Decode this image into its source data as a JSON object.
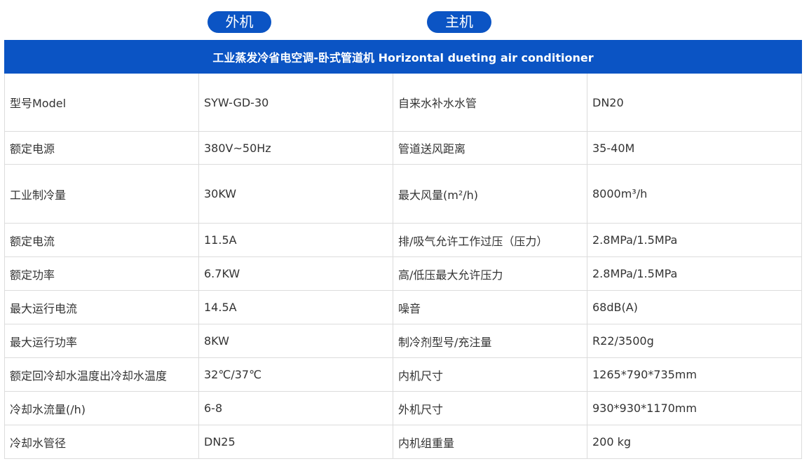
{
  "tabs": {
    "outdoor_label": "外机",
    "main_label": "主机"
  },
  "colors": {
    "accent": "#0b54c4",
    "border": "#dcdcdc",
    "text": "#333333"
  },
  "table": {
    "title": "工业蒸发冷省电空调-卧式管道机 Horizontal dueting air conditioner",
    "rows": [
      [
        "型号Model",
        "SYW-GD-30",
        "自来水补水水管",
        "DN20"
      ],
      [
        "额定电源",
        "380V~50Hz",
        "管道送风距离",
        "35-40M"
      ],
      [
        "工业制冷量",
        "30KW",
        "最大风量(m²/h)",
        "8000m³/h"
      ],
      [
        "额定电流",
        "11.5A",
        "排/吸气允许工作过压（压力）",
        "2.8MPa/1.5MPa"
      ],
      [
        "额定功率",
        "6.7KW",
        "高/低压最大允许压力",
        "2.8MPa/1.5MPa"
      ],
      [
        "最大运行电流",
        "14.5A",
        "噪音",
        "68dB(A)"
      ],
      [
        "最大运行功率",
        "8KW",
        "制冷剂型号/充注量",
        "R22/3500g"
      ],
      [
        "额定回冷却水温度出冷却水温度",
        "32℃/37℃",
        "内机尺寸",
        "1265*790*735mm"
      ],
      [
        "冷却水流量(/h)",
        "6-8",
        "外机尺寸",
        "930*930*1170mm"
      ],
      [
        "冷却水管径",
        "DN25",
        "内机组重量",
        "200 kg"
      ]
    ]
  }
}
